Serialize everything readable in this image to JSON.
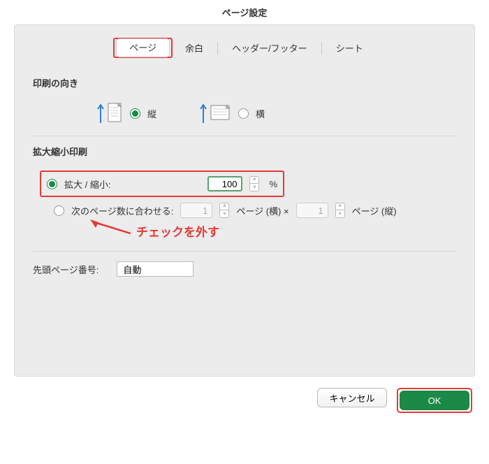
{
  "title": "ページ設定",
  "tabs": {
    "page": "ページ",
    "margins": "余白",
    "headerFooter": "ヘッダー/フッター",
    "sheet": "シート"
  },
  "orientation": {
    "title": "印刷の向き",
    "portrait": "縦",
    "landscape": "横"
  },
  "scaling": {
    "title": "拡大縮小印刷",
    "adjustTo": "拡大 / 縮小:",
    "value": "100",
    "percent": "%",
    "fitTo": "次のページ数に合わせる:",
    "fitWide": "1",
    "fitWideLabel": "ページ (横) ×",
    "fitTall": "1",
    "fitTallLabel": "ページ (縦)"
  },
  "firstPage": {
    "label": "先頭ページ番号:",
    "value": "自動"
  },
  "annotation": "チェックを外す",
  "buttons": {
    "cancel": "キャンセル",
    "ok": "OK"
  }
}
